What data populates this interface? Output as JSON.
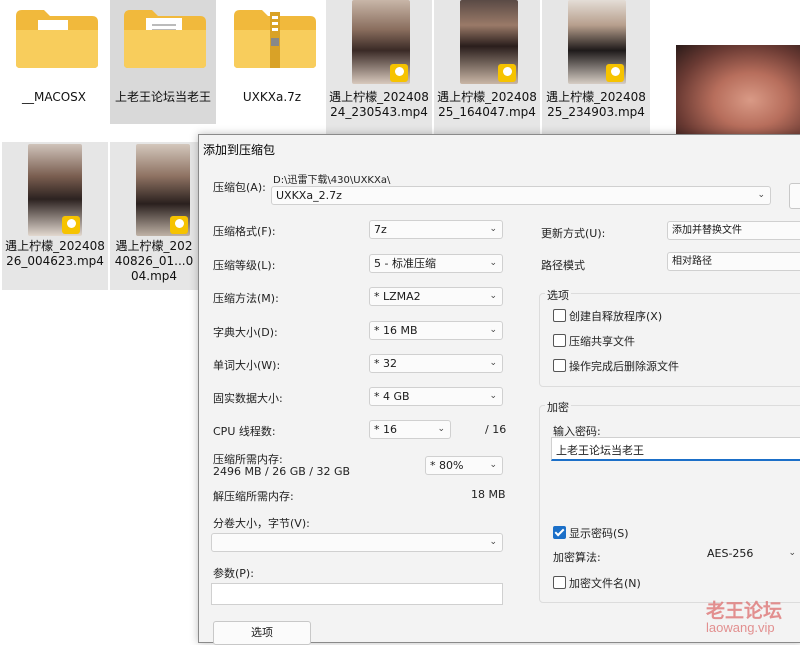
{
  "explorer": {
    "items": [
      {
        "name": "__MACOSX"
      },
      {
        "name": "上老王论坛当老王"
      },
      {
        "name": "UXKXa.7z"
      },
      {
        "name": "遇上柠檬_20240824_230543.mp4"
      },
      {
        "name": "遇上柠檬_20240825_164047.mp4"
      },
      {
        "name": "遇上柠檬_20240825_234903.mp4"
      },
      {
        "name": "遇上柠檬_20240826_004623.mp4"
      },
      {
        "name": "遇上柠檬_20240826_01...004.mp4"
      }
    ],
    "player_badge": "Player"
  },
  "dialog": {
    "title": "添加到压缩包",
    "archive_label": "压缩包(A):",
    "archive_path": "D:\\迅雷下载\\430\\UXKXa\\",
    "archive_name": "UXKXa_2.7z",
    "format_label": "压缩格式(F):",
    "format_value": "7z",
    "level_label": "压缩等级(L):",
    "level_value": "5 - 标准压缩",
    "method_label": "压缩方法(M):",
    "method_value": "*  LZMA2",
    "dict_label": "字典大小(D):",
    "dict_value": "*  16 MB",
    "word_label": "单词大小(W):",
    "word_value": "*  32",
    "solid_label": "固实数据大小:",
    "solid_value": "*  4 GB",
    "cpu_label": "CPU 线程数:",
    "cpu_value": "*  16",
    "cpu_total": "/ 16",
    "mem_label": "压缩所需内存:",
    "mem_value": "2496 MB / 26 GB / 32 GB",
    "mem_percent": "*  80%",
    "decomp_label": "解压缩所需内存:",
    "decomp_value": "18 MB",
    "split_label": "分卷大小，字节(V):",
    "split_value": "",
    "params_label": "参数(P):",
    "params_value": "",
    "options_button": "选项",
    "update_label": "更新方式(U):",
    "update_value": "添加并替换文件",
    "path_label": "路径模式",
    "path_value": "相对路径",
    "options_group": "选项",
    "opt_sfx": "创建自释放程序(X)",
    "opt_shared": "压缩共享文件",
    "opt_delete": "操作完成后删除源文件",
    "encrypt_group": "加密",
    "password_label": "输入密码:",
    "password_value": "上老王论坛当老王",
    "show_password": "显示密码(S)",
    "enc_method_label": "加密算法:",
    "enc_method_value": "AES-256",
    "encrypt_names": "加密文件名(N)"
  },
  "watermark": {
    "text": "老王论坛",
    "url": "laowang.vip"
  }
}
